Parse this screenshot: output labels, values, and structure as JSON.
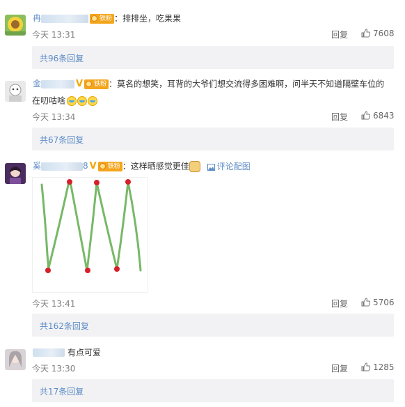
{
  "comments": [
    {
      "name_prefix": "冉",
      "name_suffix": "",
      "text": "：排排坐，吃果果",
      "time": "今天 13:31",
      "reply": "回复",
      "likes": "7608",
      "more": "共96条回复"
    },
    {
      "name_prefix": "金",
      "name_suffix": "",
      "text": "：莫名的想笑，耳背的大爷们想交流得多困难啊，问半天不知道隔壁车位的在叨咕啥",
      "text_line1": "：莫名的想笑，耳背的大爷们想交流得多困难啊，问半天不知道隔壁车位的",
      "text_line2": "在叨咕啥",
      "time": "今天 13:34",
      "reply": "回复",
      "likes": "6843",
      "more": "共67条回复"
    },
    {
      "name_prefix": "奚",
      "name_suffix": "8",
      "text": "：这样晒感觉更佳",
      "pic_link": "评论配图",
      "time": "今天 13:41",
      "reply": "回复",
      "likes": "5706",
      "more": "共162条回复"
    },
    {
      "name_prefix": "",
      "name_suffix": "",
      "text": "有点可爱",
      "time": "今天 13:30",
      "reply": "回复",
      "likes": "1285",
      "more": "共17条回复"
    }
  ],
  "badge_label": "铁粉",
  "verified_mark": "V",
  "icons": {
    "like": "thumbs-up-icon",
    "picture": "image-icon"
  },
  "colors": {
    "link": "#5d8cc4",
    "badge": "#f3a51c",
    "more_bg": "#f2f2f5"
  }
}
